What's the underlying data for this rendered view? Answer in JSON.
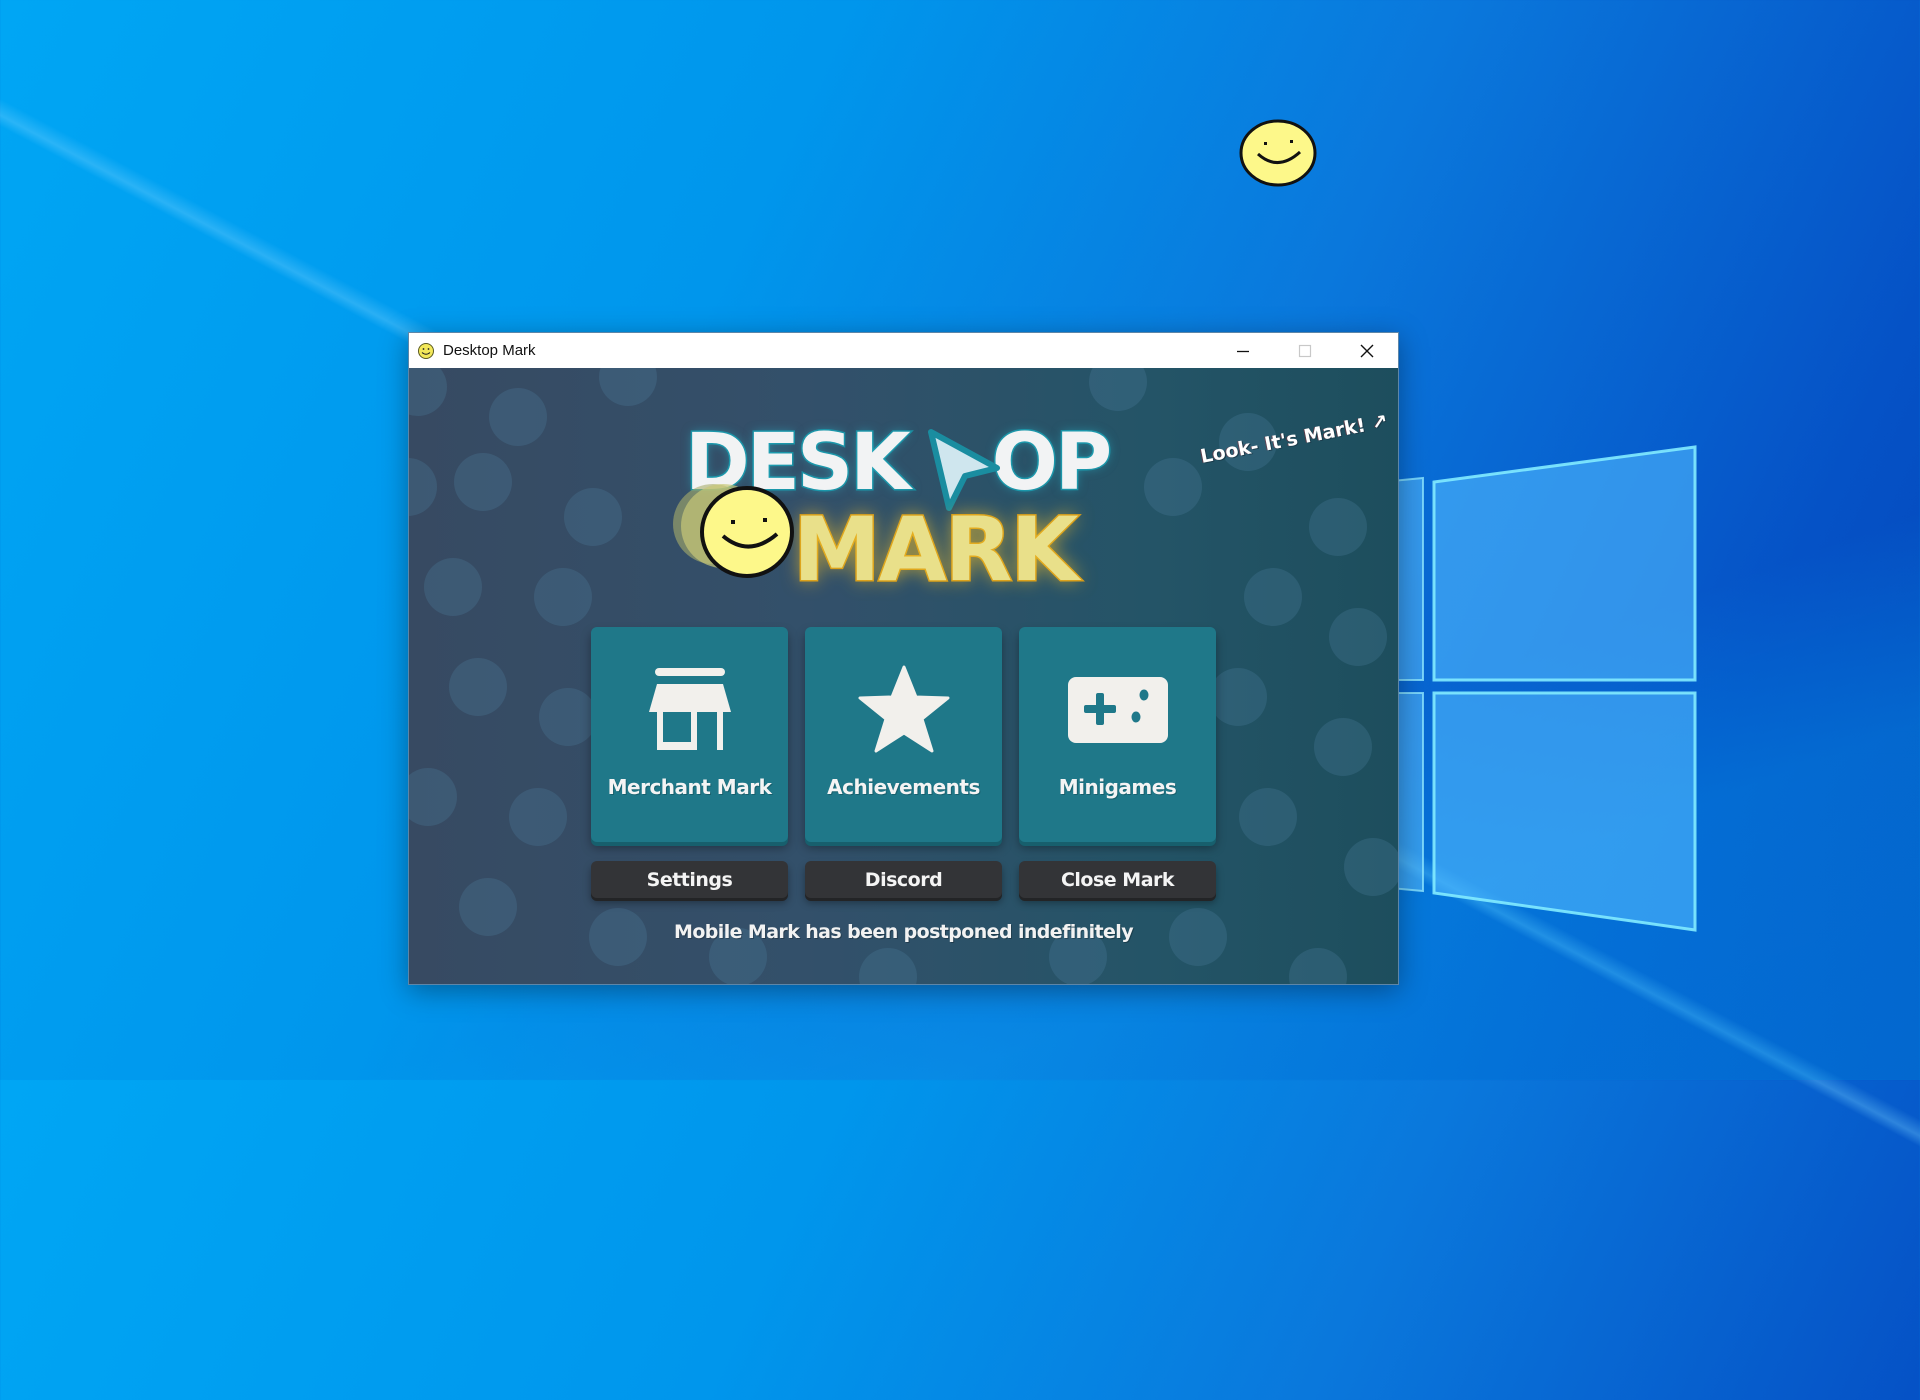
{
  "desktop": {
    "wallpaper": "windows-10-hero",
    "colors": {
      "wallpaper_light": "#00a6f4",
      "wallpaper_dark": "#0444b8"
    }
  },
  "window": {
    "title": "Desktop Mark",
    "controls": {
      "minimize": "minimize-icon",
      "maximize": "maximize-icon",
      "close": "close-icon"
    }
  },
  "app": {
    "tagline": "Look- It's Mark! ↗",
    "logo": {
      "line1": "DESK",
      "line1_end": "OP",
      "line2": "MARK"
    },
    "cards": [
      {
        "label": "Merchant Mark",
        "icon": "store-icon"
      },
      {
        "label": "Achievements",
        "icon": "star-icon"
      },
      {
        "label": "Minigames",
        "icon": "gamepad-icon"
      }
    ],
    "buttons": [
      {
        "label": "Settings"
      },
      {
        "label": "Discord"
      },
      {
        "label": "Close Mark"
      }
    ],
    "footer": "Mobile Mark has been postponed indefinitely",
    "colors": {
      "card": "#1f7889",
      "button": "#333437",
      "text": "#f4f4f4",
      "logo_accent": "#d69a18"
    }
  }
}
